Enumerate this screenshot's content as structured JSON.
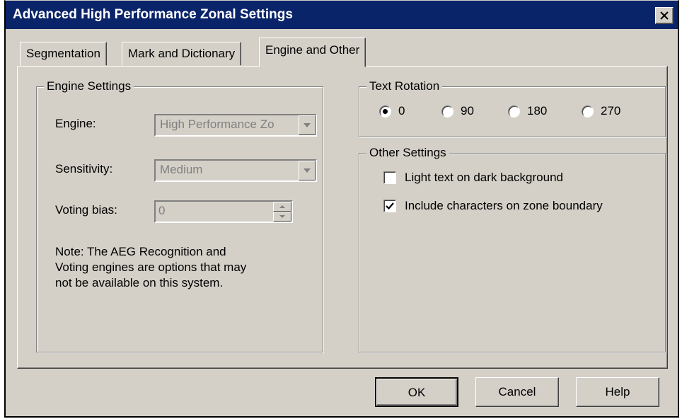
{
  "window": {
    "title": "Advanced High Performance Zonal Settings",
    "close_glyph": "×"
  },
  "tabs": [
    {
      "label": "Segmentation",
      "active": false
    },
    {
      "label": "Mark and Dictionary",
      "active": false
    },
    {
      "label": "Engine and Other",
      "active": true
    }
  ],
  "engine_settings": {
    "title": "Engine Settings",
    "engine_label": "Engine:",
    "engine_value": "High Performance Zo",
    "sensitivity_label": "Sensitivity:",
    "sensitivity_value": "Medium",
    "voting_bias_label": "Voting bias:",
    "voting_bias_value": "0",
    "note_lines": [
      "Note:  The AEG Recognition and",
      "Voting engines are options that may",
      "not be available on this system."
    ]
  },
  "text_rotation": {
    "title": "Text Rotation",
    "options": [
      {
        "label": "0",
        "selected": true
      },
      {
        "label": "90",
        "selected": false
      },
      {
        "label": "180",
        "selected": false
      },
      {
        "label": "270",
        "selected": false
      }
    ]
  },
  "other_settings": {
    "title": "Other Settings",
    "checkboxes": [
      {
        "label": "Light text on dark background",
        "checked": false
      },
      {
        "label": "Include characters on zone boundary",
        "checked": true
      }
    ]
  },
  "buttons": {
    "ok": "OK",
    "cancel": "Cancel",
    "help": "Help"
  },
  "colors": {
    "titlebar": "#0a246a",
    "face": "#d4d0c8",
    "disabled_text": "#808080"
  }
}
